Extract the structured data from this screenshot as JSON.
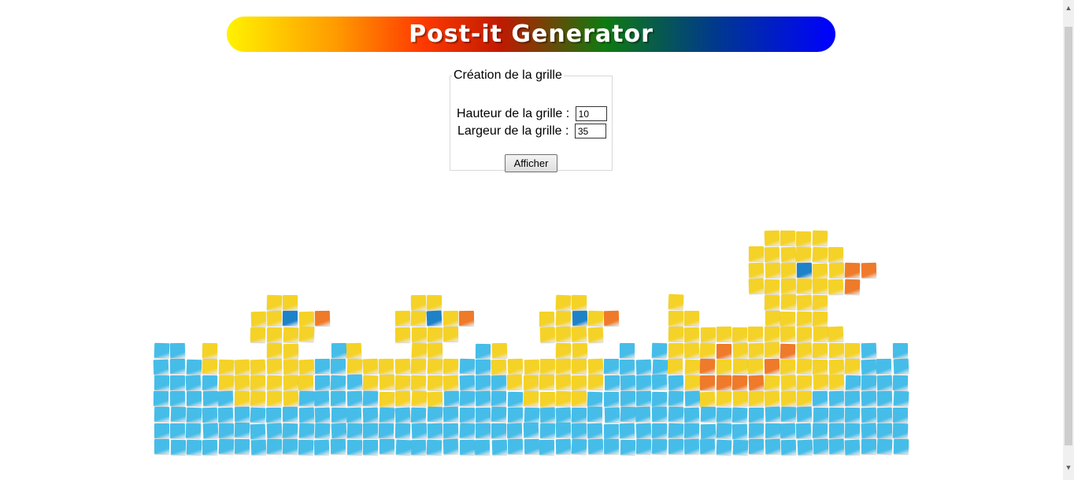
{
  "banner": {
    "title": "Post-it Generator"
  },
  "form": {
    "legend": "Création de la grille",
    "height_label": "Hauteur de la grille :",
    "height_value": "10",
    "width_label": "Largeur de la grille :",
    "width_value": "35",
    "submit_label": "Afficher"
  },
  "mosaic": {
    "grid_columns": 47,
    "grid_rows": 17,
    "colors": {
      "Y": "#f5d227",
      "B": "#46bde8",
      "E": "#1e82c8",
      "O": "#ef7a2a",
      "D": "#ef7a2a"
    },
    "rows": [
      "",
      "",
      "",
      "",
      "",
      "",
      "",
      "",
      "",
      "",
      "",
      "",
      "",
      "",
      "",
      "",
      ""
    ]
  },
  "scrollbar": {
    "up_icon": "▲",
    "down_icon": "▼"
  }
}
